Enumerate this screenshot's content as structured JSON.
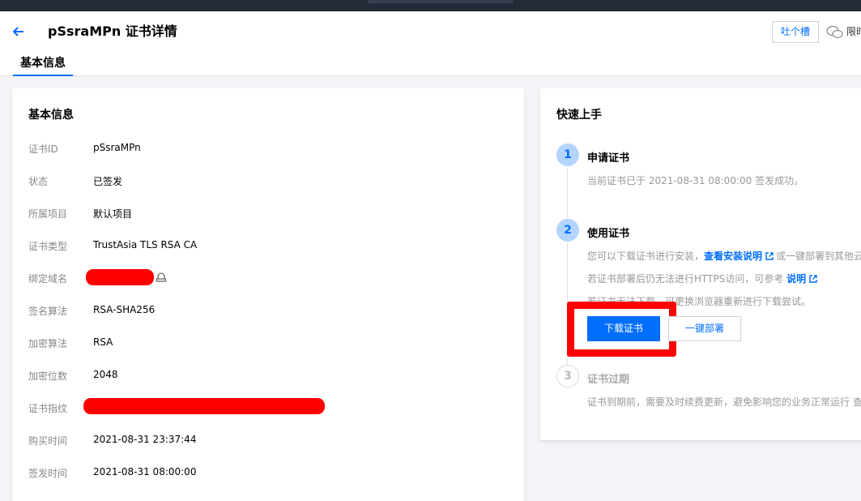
{
  "header": {
    "title": "pSsraMPn 证书详情",
    "feedback_label": "吐个槽",
    "limited_label": "限时",
    "tab_label": "基本信息"
  },
  "basic_info": {
    "title": "基本信息",
    "rows": [
      {
        "label": "证书ID",
        "value": "pSsraMPn"
      },
      {
        "label": "状态",
        "value": "已签发"
      },
      {
        "label": "所属项目",
        "value": "默认项目"
      },
      {
        "label": "证书类型",
        "value": "TrustAsia TLS RSA CA"
      },
      {
        "label": "绑定域名",
        "value": ""
      },
      {
        "label": "签名算法",
        "value": "RSA-SHA256"
      },
      {
        "label": "加密算法",
        "value": "RSA"
      },
      {
        "label": "加密位数",
        "value": "2048"
      },
      {
        "label": "证书指纹",
        "value": ""
      },
      {
        "label": "购买时间",
        "value": "2021-08-31 23:37:44"
      },
      {
        "label": "签发时间",
        "value": "2021-08-31 08:00:00"
      }
    ]
  },
  "quick_start": {
    "title": "快速上手",
    "step1": {
      "num": "1",
      "title": "申请证书",
      "text": "当前证书已于 2021-08-31 08:00:00 签发成功。"
    },
    "step2": {
      "num": "2",
      "title": "使用证书",
      "line1_prefix": "您可以下载证书进行安装，",
      "line1_link": "查看安装说明",
      "line1_suffix": "或一键部署到其他云",
      "line2_prefix": "若证书部署后仍无法进行HTTPS访问，可参考",
      "line2_link": "说明",
      "line3": "若证书无法下载，可更换浏览器重新进行下载尝试。",
      "download_label": "下载证书",
      "deploy_label": "一键部署"
    },
    "step3": {
      "num": "3",
      "title": "证书过期",
      "text": "证书到期前，需要及时续费更新，避免影响您的业务正常运行 查"
    }
  },
  "colors": {
    "accent": "#006eff",
    "highlight": "#ff0000"
  }
}
